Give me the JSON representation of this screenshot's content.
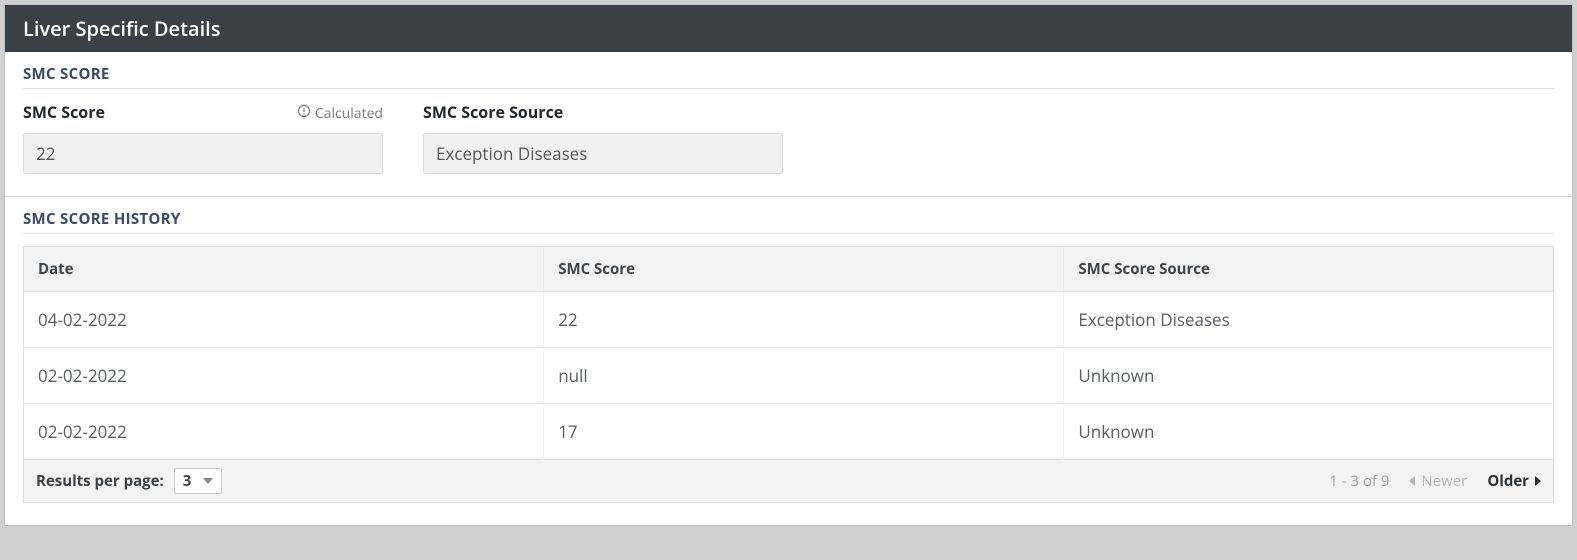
{
  "panel": {
    "title": "Liver Specific Details"
  },
  "smc_score_section": {
    "title": "SMC SCORE",
    "score_label": "SMC Score",
    "calculated_hint": "Calculated",
    "score_value": "22",
    "source_label": "SMC Score Source",
    "source_value": "Exception Diseases"
  },
  "history_section": {
    "title": "SMC SCORE HISTORY",
    "columns": {
      "date": "Date",
      "score": "SMC Score",
      "source": "SMC Score Source"
    },
    "rows": [
      {
        "date": "04-02-2022",
        "score": "22",
        "source": "Exception Diseases"
      },
      {
        "date": "02-02-2022",
        "score": "null",
        "source": "Unknown"
      },
      {
        "date": "02-02-2022",
        "score": "17",
        "source": "Unknown"
      }
    ],
    "footer": {
      "results_per_page_label": "Results per page:",
      "results_per_page_value": "3",
      "range_text": "1 - 3 of 9",
      "newer_label": "Newer",
      "older_label": "Older"
    }
  }
}
